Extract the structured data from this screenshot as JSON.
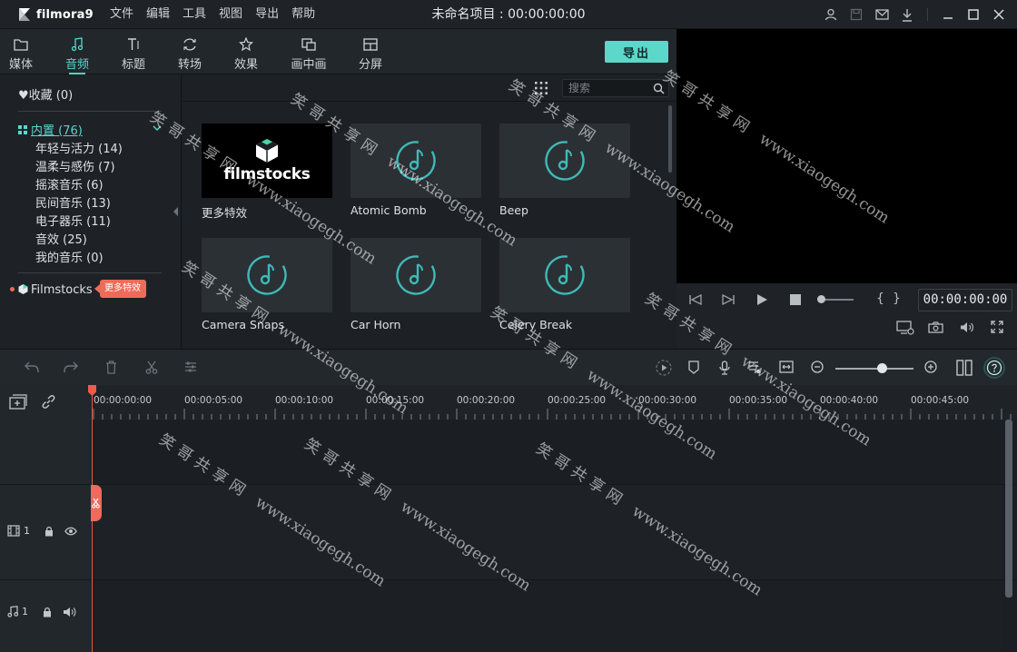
{
  "app": {
    "logo_text": "filmora9",
    "project_title": "未命名项目 : 00:00:00:00"
  },
  "menu": [
    "文件",
    "编辑",
    "工具",
    "视图",
    "导出",
    "帮助"
  ],
  "tabs": [
    {
      "label": "媒体",
      "icon": "folder-icon"
    },
    {
      "label": "音频",
      "icon": "music-note-icon",
      "active": true
    },
    {
      "label": "标题",
      "icon": "title-icon"
    },
    {
      "label": "转场",
      "icon": "transition-icon"
    },
    {
      "label": "效果",
      "icon": "effects-icon"
    },
    {
      "label": "画中画",
      "icon": "pip-icon"
    },
    {
      "label": "分屏",
      "icon": "split-screen-icon"
    }
  ],
  "export_label": "导出",
  "library": {
    "favorites": "收藏 (0)",
    "builtin": "内置 (76)",
    "categories": [
      "年轻与活力 (14)",
      "温柔与感伤 (7)",
      "摇滚音乐 (6)",
      "民间音乐 (13)",
      "电子器乐 (11)",
      "音效 (25)",
      "我的音乐 (0)"
    ],
    "filmstocks": "Filmstocks",
    "more_badge": "更多特效"
  },
  "search": {
    "placeholder": "搜索"
  },
  "media_cards": [
    {
      "label": "更多特效",
      "thumb_text": "filmstocks"
    },
    {
      "label": "Atomic Bomb"
    },
    {
      "label": "Beep"
    },
    {
      "label": "Camera Snaps"
    },
    {
      "label": "Car Horn"
    },
    {
      "label": "Celery Break"
    }
  ],
  "player": {
    "timecode": "00:00:00:00",
    "bracket_open": "{",
    "bracket_close": "}"
  },
  "ruler": [
    "00:00:00:00",
    "00:00:05:00",
    "00:00:10:00",
    "00:00:15:00",
    "00:00:20:00",
    "00:00:25:00",
    "00:00:30:00",
    "00:00:35:00",
    "00:00:40:00",
    "00:00:45:00"
  ],
  "tracks": {
    "video_label": "1",
    "audio_label": "1"
  },
  "watermark": {
    "cn": "笑哥共享网",
    "url": "www.xiaogegh.com"
  },
  "colors": {
    "accent": "#5cd7c9",
    "playhead": "#f05a4a",
    "badge": "#ee6b59"
  }
}
